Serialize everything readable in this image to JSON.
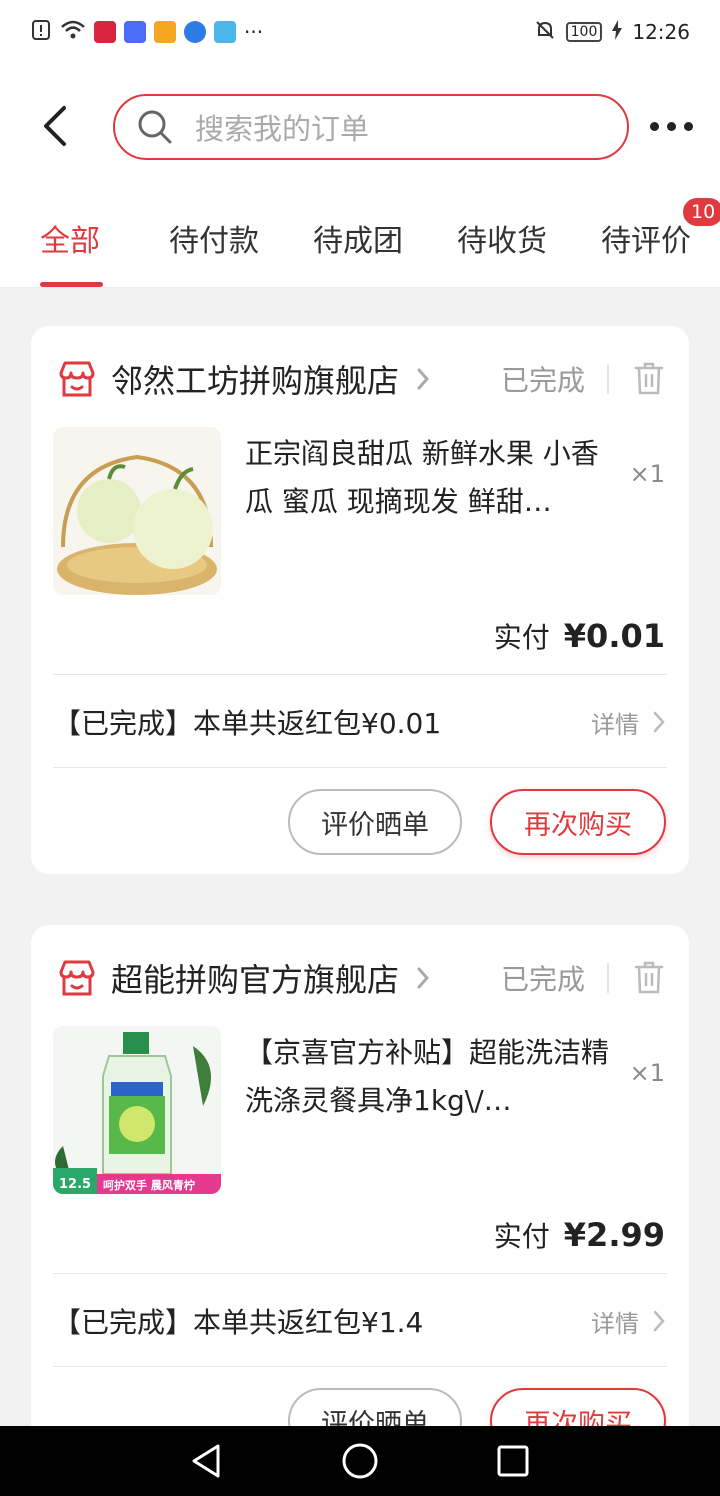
{
  "status_bar": {
    "time": "12:26",
    "battery": "100"
  },
  "header": {
    "search_placeholder": "搜索我的订单"
  },
  "tabs": [
    {
      "label": "全部",
      "active": true
    },
    {
      "label": "待付款"
    },
    {
      "label": "待成团"
    },
    {
      "label": "待收货"
    },
    {
      "label": "待评价",
      "badge": "10"
    }
  ],
  "orders": [
    {
      "store_name": "邻然工坊拼购旗舰店",
      "status": "已完成",
      "product_title": "正宗阎良甜瓜 新鲜水果 小香瓜 蜜瓜 现摘现发 鲜甜…",
      "quantity": "×1",
      "paid_label": "实付",
      "paid_amount": "¥0.01",
      "rebate_text": "【已完成】本单共返红包¥0.01",
      "detail_label": "详情",
      "review_button": "评价晒单",
      "rebuy_button": "再次购买"
    },
    {
      "store_name": "超能拼购官方旗舰店",
      "status": "已完成",
      "product_title": "【京喜官方补贴】超能洗洁精洗涤灵餐具净1kg\\/…",
      "quantity": "×1",
      "paid_label": "实付",
      "paid_amount": "¥2.99",
      "rebate_text": "【已完成】本单共返红包¥1.4",
      "detail_label": "详情",
      "review_button": "评价晒单",
      "rebuy_button": "再次购买",
      "image_text": {
        "price_tag": "12.5",
        "slogan": "呵护双手 晨风青柠"
      }
    }
  ],
  "colors": {
    "accent": "#e0393e"
  }
}
